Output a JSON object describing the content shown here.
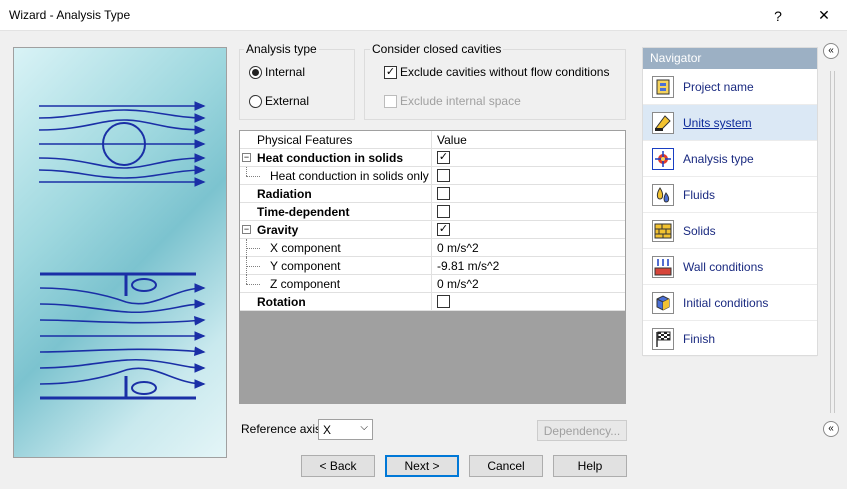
{
  "window": {
    "title": "Wizard - Analysis Type",
    "help_glyph": "?",
    "close_glyph": "✕"
  },
  "analysis_type": {
    "legend": "Analysis type",
    "options": [
      {
        "label": "Internal",
        "selected": true
      },
      {
        "label": "External",
        "selected": false
      }
    ]
  },
  "cavities": {
    "legend": "Consider closed cavities",
    "exclude_no_flow": {
      "label": "Exclude cavities without flow conditions",
      "checked": true
    },
    "exclude_internal": {
      "label": "Exclude internal space",
      "checked": false,
      "disabled": true
    }
  },
  "physical_features": {
    "headers": [
      "Physical Features",
      "Value"
    ],
    "rows": [
      {
        "name": "Heat conduction in solids",
        "bold": true,
        "level": 0,
        "expander": "minus",
        "value_type": "check",
        "checked": true,
        "value": ""
      },
      {
        "name": "Heat conduction in solids only",
        "bold": false,
        "level": 1,
        "expander": "",
        "value_type": "check",
        "checked": false,
        "value": ""
      },
      {
        "name": "Radiation",
        "bold": true,
        "level": 0,
        "expander": "",
        "value_type": "check",
        "checked": false,
        "value": ""
      },
      {
        "name": "Time-dependent",
        "bold": true,
        "level": 0,
        "expander": "",
        "value_type": "check",
        "checked": false,
        "value": ""
      },
      {
        "name": "Gravity",
        "bold": true,
        "level": 0,
        "expander": "minus",
        "value_type": "check",
        "checked": true,
        "value": ""
      },
      {
        "name": "X component",
        "bold": false,
        "level": 1,
        "expander": "",
        "value_type": "text",
        "checked": false,
        "value": "0 m/s^2"
      },
      {
        "name": "Y component",
        "bold": false,
        "level": 1,
        "expander": "",
        "value_type": "text",
        "checked": false,
        "value": "-9.81 m/s^2"
      },
      {
        "name": "Z component",
        "bold": false,
        "level": 1,
        "expander": "",
        "value_type": "text",
        "checked": false,
        "value": "0 m/s^2"
      },
      {
        "name": "Rotation",
        "bold": true,
        "level": 0,
        "expander": "",
        "value_type": "check",
        "checked": false,
        "value": ""
      }
    ]
  },
  "reference_axis": {
    "label": "Reference axis:",
    "value": "X"
  },
  "buttons": {
    "dependency": "Dependency...",
    "back": "< Back",
    "next": "Next >",
    "cancel": "Cancel",
    "help": "Help"
  },
  "navigator": {
    "title": "Navigator",
    "collapse_glyph": "«",
    "items": [
      {
        "label": "Project name",
        "icon": "project-name-icon",
        "active": false
      },
      {
        "label": "Units system",
        "icon": "units-system-icon",
        "active": true
      },
      {
        "label": "Analysis type",
        "icon": "analysis-type-icon",
        "active": false
      },
      {
        "label": "Fluids",
        "icon": "fluids-icon",
        "active": false
      },
      {
        "label": "Solids",
        "icon": "solids-icon",
        "active": false
      },
      {
        "label": "Wall conditions",
        "icon": "wall-conditions-icon",
        "active": false
      },
      {
        "label": "Initial conditions",
        "icon": "initial-conditions-icon",
        "active": false
      },
      {
        "label": "Finish",
        "icon": "finish-icon",
        "active": false
      }
    ]
  },
  "colors": {
    "accent": "#0078d7",
    "navigator_header": "#9cb0c4",
    "flow_lines": "#1a2fa6"
  }
}
